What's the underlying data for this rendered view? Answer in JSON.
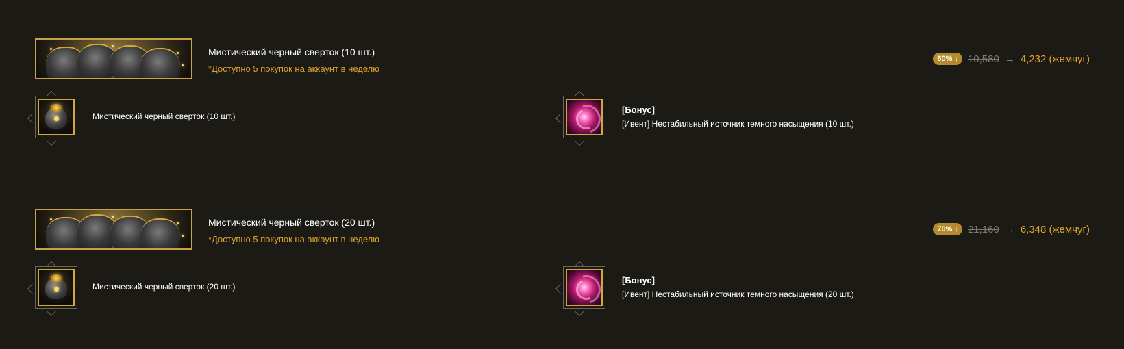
{
  "products": [
    {
      "title": "Мистический черный сверток (10 шт.)",
      "note": "*Доступно 5 покупок на аккаунт в неделю",
      "discount_badge": "60% ↓",
      "old_price": "10,580",
      "arrow": "→",
      "new_price": "4,232 (жемчуг)",
      "item_label": "Мистический черный сверток (10 шт.)",
      "bonus_title": "[Бонус]",
      "bonus_label": "[Ивент] Нестабильный источник темного насыщения (10 шт.)"
    },
    {
      "title": "Мистический черный сверток (20 шт.)",
      "note": "*Доступно 5 покупок на аккаунт в неделю",
      "discount_badge": "70% ↓",
      "old_price": "21,160",
      "arrow": "→",
      "new_price": "6,348 (жемчуг)",
      "item_label": "Мистический черный сверток (20 шт.)",
      "bonus_title": "[Бонус]",
      "bonus_label": "[Ивент] Нестабильный источник темного насыщения (20 шт.)"
    }
  ],
  "colors": {
    "background": "#1b1a14",
    "accent_gold": "#e0a32e",
    "frame_gold": "#d4a640",
    "badge": "#b58a2c",
    "old_price": "#7d7a70"
  },
  "icons": {
    "banner": "black-pouches-banner-image",
    "item": "black-pouch-icon",
    "bonus": "dark-galaxy-source-icon"
  }
}
